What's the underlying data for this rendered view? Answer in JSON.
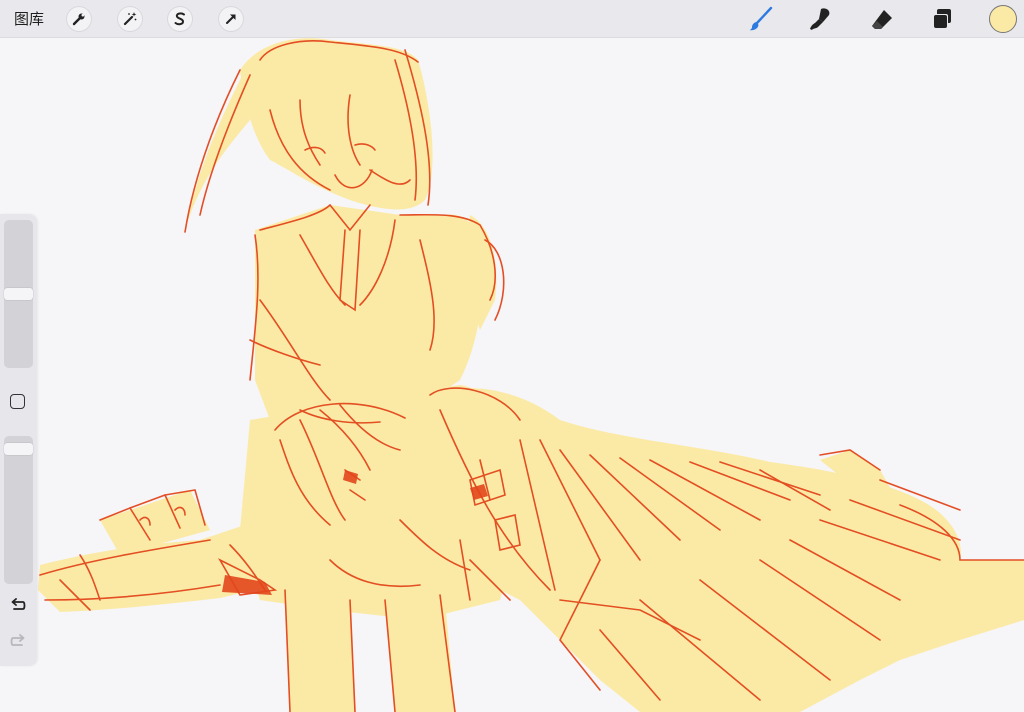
{
  "topbar": {
    "gallery_label": "图库",
    "left_tools": [
      {
        "name": "actions",
        "icon": "wrench-icon"
      },
      {
        "name": "adjustments",
        "icon": "magic-wand-icon"
      },
      {
        "name": "selection",
        "icon": "selection-s-icon"
      },
      {
        "name": "transform",
        "icon": "arrow-cursor-icon"
      }
    ],
    "right_tools": [
      {
        "name": "brush",
        "icon": "brush-icon",
        "active": true
      },
      {
        "name": "smudge",
        "icon": "smudge-icon",
        "active": false
      },
      {
        "name": "eraser",
        "icon": "eraser-icon",
        "active": false
      },
      {
        "name": "layers",
        "icon": "layers-icon",
        "active": false
      }
    ],
    "current_color": "#fbe9a6"
  },
  "sidebar": {
    "brush_size_level": 0.5,
    "opacity_level": 0.95,
    "modify_button": "square-icon",
    "undo_icon": "undo-icon",
    "redo_icon": "redo-icon"
  },
  "canvas": {
    "artwork": "sketch",
    "fill_color": "#fbeaa5",
    "line_color": "#e2461c",
    "background_color": "#f6f5f7"
  }
}
